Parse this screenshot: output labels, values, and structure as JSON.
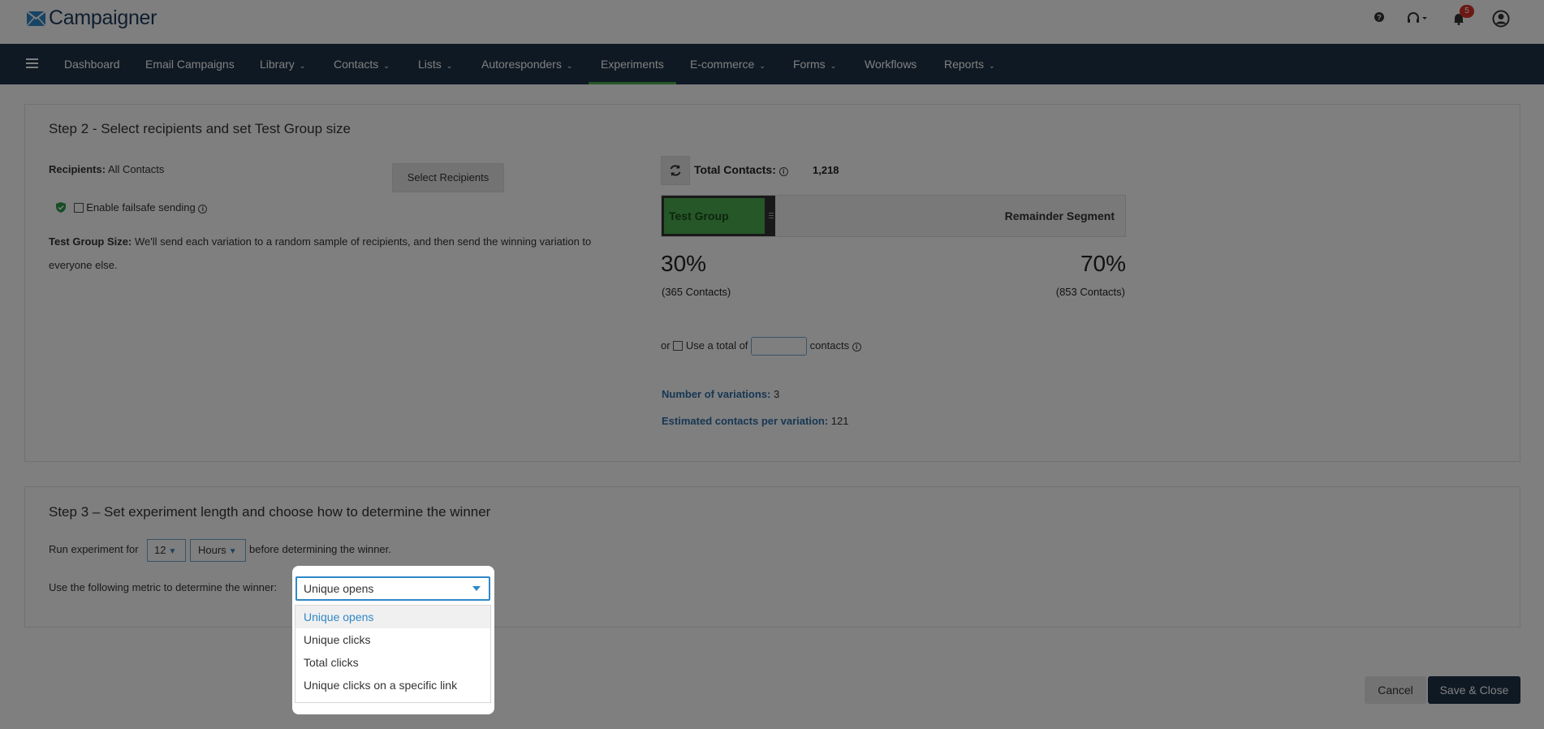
{
  "header": {
    "logo_text": "Campaigner",
    "notification_count": "5"
  },
  "nav": {
    "items": [
      {
        "label": "Dashboard",
        "caret": false
      },
      {
        "label": "Email Campaigns",
        "caret": false
      },
      {
        "label": "Library",
        "caret": true
      },
      {
        "label": "Contacts",
        "caret": true
      },
      {
        "label": "Lists",
        "caret": true
      },
      {
        "label": "Autoresponders",
        "caret": true
      },
      {
        "label": "Experiments",
        "caret": false,
        "active": true
      },
      {
        "label": "E-commerce",
        "caret": true
      },
      {
        "label": "Forms",
        "caret": true
      },
      {
        "label": "Workflows",
        "caret": false
      },
      {
        "label": "Reports",
        "caret": true
      }
    ]
  },
  "step2": {
    "title": "Step 2 - Select recipients and set Test Group size",
    "recipients_label": "Recipients:",
    "recipients_value": "All Contacts",
    "select_recipients_button": "Select Recipients",
    "failsafe_label": "Enable failsafe sending",
    "test_group_size_label": "Test Group Size:",
    "test_group_size_text_line1": "We'll send each variation to a random sample of recipients, and then send the winning variation to",
    "test_group_size_text_line2": "everyone else.",
    "total_contacts_label": "Total Contacts:",
    "total_contacts_value": "1,218",
    "test_group_label": "Test Group",
    "remainder_label": "Remainder Segment",
    "test_group_fraction": 0.3,
    "test_percent": "30%",
    "test_contacts": "(365 Contacts)",
    "remainder_percent": "70%",
    "remainder_contacts": "(853 Contacts)",
    "or_label": "or",
    "use_total_label": "Use a total of",
    "contacts_label": "contacts",
    "use_total_value": "",
    "variations_label": "Number of variations:",
    "variations_value": "3",
    "estimated_label": "Estimated contacts per variation:",
    "estimated_value": "121"
  },
  "step3": {
    "title": "Step 3 – Set experiment length and choose how to determine the winner",
    "run_prefix": "Run experiment for",
    "run_value": "12",
    "run_unit": "Hours",
    "run_suffix": "before determining the winner.",
    "metric_label": "Use the following metric to determine the winner:",
    "metric_selected": "Unique opens",
    "metric_options": [
      "Unique opens",
      "Unique clicks",
      "Total clicks",
      "Unique clicks on a specific link"
    ]
  },
  "footer": {
    "cancel_label": "Cancel",
    "save_label": "Save & Close"
  },
  "colors": {
    "nav_bg": "#1f3348",
    "accent_green": "#4caf50",
    "accent_blue": "#2f88c9",
    "notification_red": "#d9322b"
  }
}
